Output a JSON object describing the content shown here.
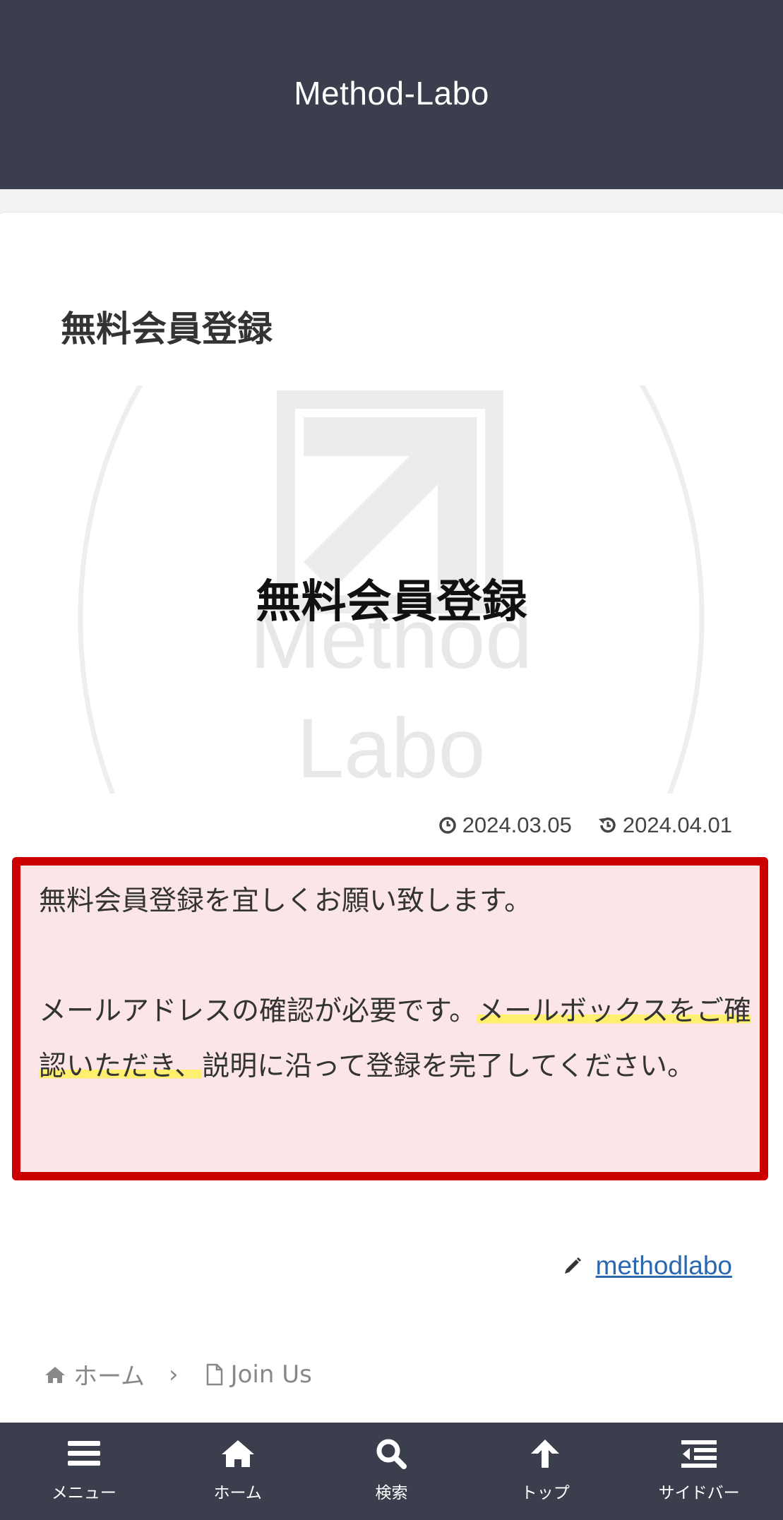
{
  "header": {
    "site_title": "Method-Labo"
  },
  "article": {
    "title": "無料会員登録",
    "eyecatch": {
      "title": "無料会員登録",
      "logo_line1": "Method",
      "logo_line2": "Labo"
    },
    "published": "2024.03.05",
    "updated": "2024.04.01",
    "message": {
      "line1": "無料会員登録を宜しくお願い致します。",
      "p2_before": "メールアドレスの確認が必要です。",
      "p2_marked": "メールボックスをご確認いただき、",
      "p2_after": "説明に沿って登録を完了してください。"
    },
    "author": "methodlabo"
  },
  "breadcrumb": {
    "home": "ホーム",
    "current": "Join Us"
  },
  "bottom_nav": {
    "menu": "メニュー",
    "home": "ホーム",
    "search": "検索",
    "top": "トップ",
    "sidebar": "サイドバー"
  },
  "colors": {
    "header_bg": "#3b3f4d",
    "message_border": "#cc0000",
    "message_bg": "#fbe5e6",
    "marker": "#ffef6e",
    "link": "#2b68b0"
  }
}
